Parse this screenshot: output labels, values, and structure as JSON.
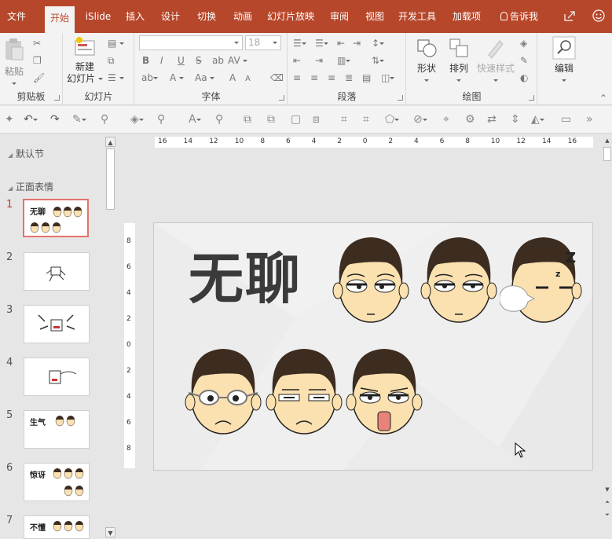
{
  "tabs": [
    "文件",
    "开始",
    "iSlide",
    "插入",
    "设计",
    "切换",
    "动画",
    "幻灯片放映",
    "审阅",
    "视图",
    "开发工具",
    "加载项"
  ],
  "tell_me": "告诉我",
  "ribbon": {
    "clipboard": {
      "paste": "粘贴",
      "label": "剪贴板"
    },
    "slides": {
      "new_slide_line1": "新建",
      "new_slide_line2": "幻灯片",
      "label": "幻灯片"
    },
    "font": {
      "font_size": "18",
      "label": "字体",
      "bold": "B",
      "italic": "I",
      "underline": "U",
      "strike": "S",
      "grow": "A",
      "shrink": "A",
      "clear": "Aa"
    },
    "paragraph": {
      "label": "段落"
    },
    "drawing": {
      "shapes": "形状",
      "arrange": "排列",
      "quick_styles": "快速样式",
      "label": "绘图"
    },
    "editing": {
      "label": "编辑"
    }
  },
  "sidebar": {
    "sections": [
      "默认节",
      "正面表情"
    ],
    "slides": [
      {
        "num": "1",
        "title": "无聊"
      },
      {
        "num": "2",
        "title": ""
      },
      {
        "num": "3",
        "title": ""
      },
      {
        "num": "4",
        "title": ""
      },
      {
        "num": "5",
        "title": "生气"
      },
      {
        "num": "6",
        "title": "惊讶"
      },
      {
        "num": "7",
        "title": "不懂"
      }
    ]
  },
  "ruler": {
    "h": [
      "16",
      "14",
      "12",
      "10",
      "8",
      "6",
      "4",
      "2",
      "0",
      "2",
      "4",
      "6",
      "8",
      "10",
      "12",
      "14",
      "16"
    ],
    "v": [
      "8",
      "6",
      "4",
      "2",
      "0",
      "2",
      "4",
      "6",
      "8"
    ]
  },
  "slide": {
    "title": "无聊",
    "sleep_z": "Z",
    "sleep_z_small": "z"
  },
  "colors": {
    "accent": "#b7472a",
    "selected_border": "#e3746a",
    "hair": "#3d2c20",
    "skin": "#fbe0b0"
  }
}
